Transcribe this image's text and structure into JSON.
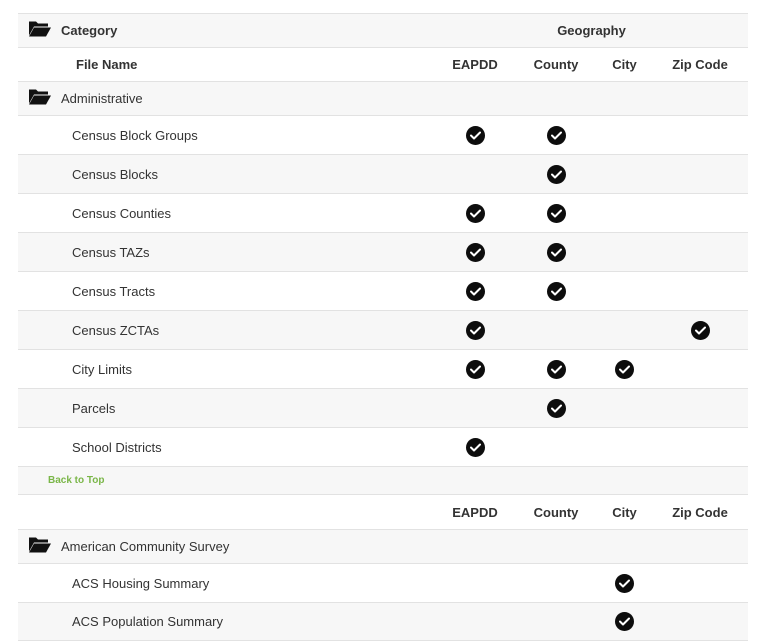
{
  "header": {
    "category_label": "Category",
    "geography_label": "Geography",
    "file_name_label": "File Name"
  },
  "columns": [
    "EAPDD",
    "County",
    "City",
    "Zip Code"
  ],
  "sections": [
    {
      "name": "Administrative",
      "rows": [
        {
          "name": "Census Block Groups",
          "eapdd": true,
          "county": true,
          "city": false,
          "zip": false
        },
        {
          "name": "Census Blocks",
          "eapdd": false,
          "county": true,
          "city": false,
          "zip": false
        },
        {
          "name": "Census Counties",
          "eapdd": true,
          "county": true,
          "city": false,
          "zip": false
        },
        {
          "name": "Census TAZs",
          "eapdd": true,
          "county": true,
          "city": false,
          "zip": false
        },
        {
          "name": "Census Tracts",
          "eapdd": true,
          "county": true,
          "city": false,
          "zip": false
        },
        {
          "name": "Census ZCTAs",
          "eapdd": true,
          "county": false,
          "city": false,
          "zip": true
        },
        {
          "name": "City Limits",
          "eapdd": true,
          "county": true,
          "city": true,
          "zip": false
        },
        {
          "name": "Parcels",
          "eapdd": false,
          "county": true,
          "city": false,
          "zip": false
        },
        {
          "name": "School Districts",
          "eapdd": true,
          "county": false,
          "city": false,
          "zip": false
        }
      ]
    },
    {
      "name": "American Community Survey",
      "rows": [
        {
          "name": "ACS Housing Summary",
          "eapdd": false,
          "county": false,
          "city": true,
          "zip": false
        },
        {
          "name": "ACS Population Summary",
          "eapdd": false,
          "county": false,
          "city": true,
          "zip": false
        }
      ]
    }
  ],
  "back_to_top_label": "Back to Top",
  "icons": {
    "folder": "folder-open-icon",
    "check": "check-circle-icon"
  },
  "colors": {
    "link": "#7ab648",
    "row_shade": "#f7f7f7",
    "check": "#0d0d0d"
  }
}
